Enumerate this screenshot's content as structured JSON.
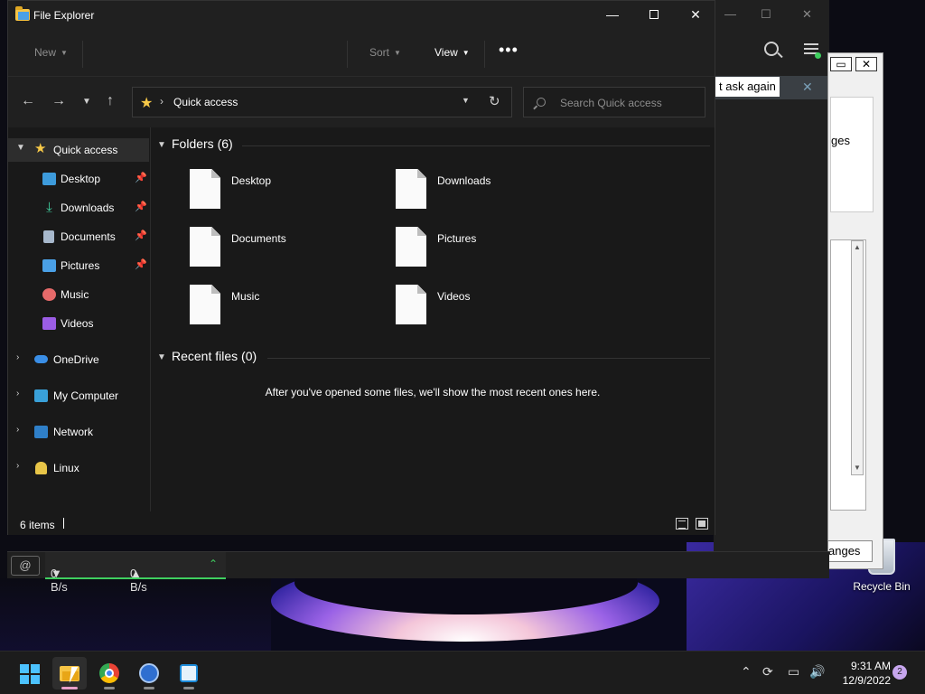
{
  "desktop": {
    "recycle_bin_label": "Recycle Bin"
  },
  "background_window": {
    "notification_text": "t ask again",
    "dialog_text": "ges",
    "apply_button": "anges"
  },
  "explorer": {
    "title": "File Explorer",
    "cmdbar": {
      "new": "New",
      "sort": "Sort",
      "view": "View",
      "more": "•••"
    },
    "address": {
      "location": "Quick access",
      "search_placeholder": "Search Quick access"
    },
    "nav": {
      "quick_access": "Quick access",
      "pinned": [
        {
          "label": "Desktop",
          "pinned": true
        },
        {
          "label": "Downloads",
          "pinned": true
        },
        {
          "label": "Documents",
          "pinned": true
        },
        {
          "label": "Pictures",
          "pinned": true
        },
        {
          "label": "Music",
          "pinned": false
        },
        {
          "label": "Videos",
          "pinned": false
        }
      ],
      "roots": [
        "OneDrive",
        "My Computer",
        "Network",
        "Linux"
      ]
    },
    "content": {
      "folders_header": "Folders (6)",
      "folders": [
        "Desktop",
        "Downloads",
        "Documents",
        "Pictures",
        "Music",
        "Videos"
      ],
      "recent_header": "Recent files (0)",
      "recent_empty": "After you've opened some files, we'll show the most recent ones here."
    },
    "status": {
      "item_count": "6 items"
    }
  },
  "net_meter": {
    "download": "0 B/s",
    "upload": "0 B/s"
  },
  "taskbar": {
    "time": "9:31 AM",
    "date": "12/9/2022",
    "notification_count": "2"
  },
  "colors": {
    "accent": "#4cc2ff",
    "star": "#f7c948",
    "net_green": "#3fcf5f"
  }
}
